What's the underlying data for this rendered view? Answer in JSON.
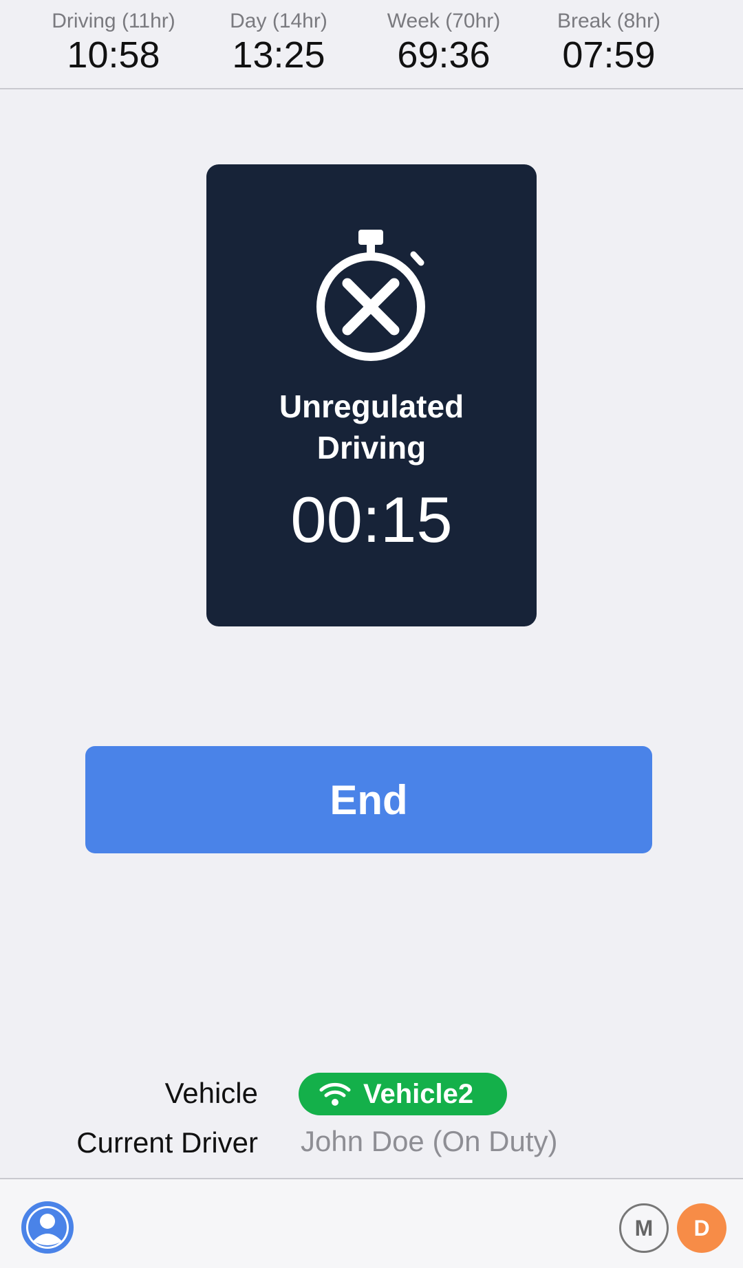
{
  "timers": [
    {
      "label": "Driving (11hr)",
      "value": "10:58"
    },
    {
      "label": "Day (14hr)",
      "value": "13:25"
    },
    {
      "label": "Week (70hr)",
      "value": "69:36"
    },
    {
      "label": "Break (8hr)",
      "value": "07:59"
    }
  ],
  "status": {
    "label": "Unregulated Driving",
    "timer": "00:15",
    "icon": "stopwatch-x-icon"
  },
  "actions": {
    "end_label": "End"
  },
  "info": {
    "vehicle_label": "Vehicle",
    "vehicle_value": "Vehicle2",
    "driver_label": "Current Driver",
    "driver_value": "John Doe (On Duty)"
  },
  "bottom_bar": {
    "mode_m": "M",
    "mode_d": "D"
  },
  "colors": {
    "card_bg": "#172338",
    "accent_blue": "#4a83e8",
    "connected_green": "#14b04a",
    "duty_orange": "#f78c47"
  }
}
